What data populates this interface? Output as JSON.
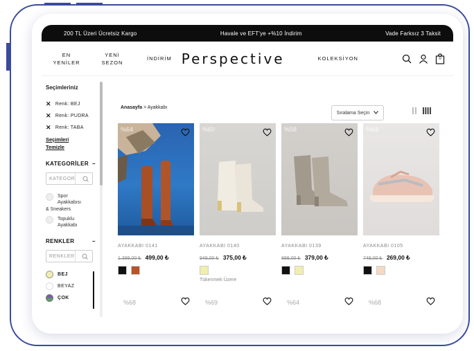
{
  "announcement": {
    "left": "200 TL Üzeri Ücretsiz Kargo",
    "center": "Havale ve EFT'ye +%10 İndirim",
    "right": "Vade Farksız 3 Taksit"
  },
  "nav": {
    "new_line1": "EN",
    "new_line2": "YENİLER",
    "season_line1": "YENİ",
    "season_line2": "SEZON",
    "sale": "İNDİRİM",
    "logo": "Perspective",
    "collection": "KOLEKSİYON",
    "icons": [
      "search-icon",
      "user-icon",
      "cart-icon"
    ],
    "cart_count": "0"
  },
  "sidebar": {
    "selections_title": "Seçimleriniz",
    "chips": [
      "Renk: BEJ",
      "Renk: PUDRA",
      "Renk: TABA"
    ],
    "clear_line1": "Seçimleri",
    "clear_line2": "Temizle",
    "categories_title": "KATEGORİLER",
    "categories_search_placeholder": "KATEGOR",
    "categories": [
      {
        "label_lines": [
          "Spor",
          "Ayakkabısı",
          "& Sneakers"
        ]
      },
      {
        "label_lines": [
          "Topuklu",
          "Ayakkabı"
        ]
      }
    ],
    "colors_title": "RENKLER",
    "colors_search_placeholder": "RENKLER",
    "colors": [
      {
        "label": "BEJ",
        "hex": "#f0eeb0",
        "selected": true
      },
      {
        "label": "BEYAZ",
        "hex": "#ffffff",
        "selected": false
      },
      {
        "label": "ÇOK",
        "hex": "#7a5ea8",
        "selected": false
      }
    ]
  },
  "breadcrumb": {
    "home": "Anasayfa",
    "separator": ">",
    "current": "Ayakkabı"
  },
  "sort": {
    "label": "Sıralama Seçin"
  },
  "products": [
    {
      "badge": "%64",
      "name": "AYAKKABI 0141",
      "old_price": "1.399,00 ₺",
      "price": "499,00 ₺",
      "swatches": [
        "#111111",
        "#b8532a"
      ],
      "stock": ""
    },
    {
      "badge": "%60",
      "name": "AYAKKABI 0140",
      "old_price": "949,00 ₺",
      "price": "375,00 ₺",
      "swatches": [
        "#f0eeb0"
      ],
      "stock": "Tükenmek Üzere"
    },
    {
      "badge": "%58",
      "name": "AYAKKABI 0139",
      "old_price": "899,00 ₺",
      "price": "379,00 ₺",
      "swatches": [
        "#111111",
        "#f0eeb0"
      ],
      "stock": ""
    },
    {
      "badge": "%64",
      "name": "AYAKKABI 0105",
      "old_price": "749,00 ₺",
      "price": "269,00 ₺",
      "swatches": [
        "#111111",
        "#f5d9c2"
      ],
      "stock": ""
    }
  ],
  "next_row_badges": [
    "%68",
    "%69",
    "%64",
    "%68"
  ],
  "colors": {
    "brand_frame": "#3a4b9c",
    "announcement_bg": "#0d0d0d"
  }
}
